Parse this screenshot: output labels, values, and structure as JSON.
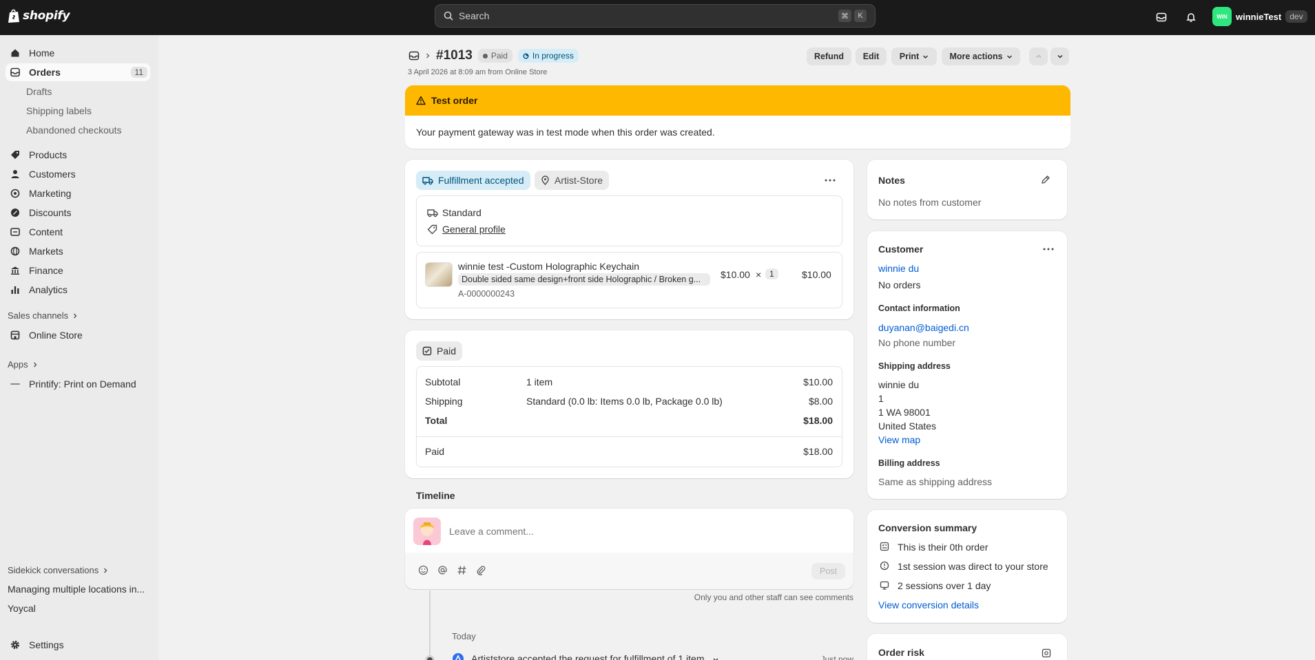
{
  "topbar": {
    "logo_text": "shopify",
    "search_placeholder": "Search",
    "shortcut_cmd": "⌘",
    "shortcut_key": "K",
    "user_initials": "WIN",
    "user_name": "winnieTest",
    "user_tag": "dev"
  },
  "sidebar": {
    "home": "Home",
    "orders": "Orders",
    "orders_count": "11",
    "drafts": "Drafts",
    "shipping_labels": "Shipping labels",
    "abandoned": "Abandoned checkouts",
    "products": "Products",
    "customers": "Customers",
    "marketing": "Marketing",
    "discounts": "Discounts",
    "content": "Content",
    "markets": "Markets",
    "finance": "Finance",
    "analytics": "Analytics",
    "sales_channels": "Sales channels",
    "online_store": "Online Store",
    "apps": "Apps",
    "printify": "Printify: Print on Demand",
    "sidekick": "Sidekick conversations",
    "conv1": "Managing multiple locations in...",
    "conv2": "Yoycal",
    "settings": "Settings"
  },
  "header": {
    "order_number": "#1013",
    "badge_paid": "Paid",
    "badge_progress": "In progress",
    "subtitle": "3 April 2026 at 8:09 am from Online Store",
    "refund": "Refund",
    "edit": "Edit",
    "print": "Print",
    "more_actions": "More actions"
  },
  "banner": {
    "title": "Test order",
    "body": "Your payment gateway was in test mode when this order was created."
  },
  "fulfillment": {
    "status": "Fulfillment accepted",
    "location": "Artist-Store",
    "method": "Standard",
    "profile": "General profile",
    "item_title": "winnie test -Custom Holographic Keychain",
    "item_variant": "Double sided same design+front side Holographic / Broken g...",
    "item_sku": "A-0000000243",
    "item_price": "$10.00",
    "item_times": "×",
    "item_qty": "1",
    "item_total": "$10.00"
  },
  "payment": {
    "badge": "Paid",
    "subtotal_label": "Subtotal",
    "subtotal_desc": "1 item",
    "subtotal_value": "$10.00",
    "shipping_label": "Shipping",
    "shipping_desc": "Standard (0.0 lb: Items 0.0 lb, Package 0.0 lb)",
    "shipping_value": "$8.00",
    "total_label": "Total",
    "total_value": "$18.00",
    "paid_label": "Paid",
    "paid_value": "$18.00"
  },
  "timeline": {
    "title": "Timeline",
    "comment_placeholder": "Leave a comment...",
    "post": "Post",
    "staff_note": "Only you and other staff can see comments",
    "today": "Today",
    "event": "Artiststore accepted the request for fulfillment of 1 item",
    "event_time": "Just now"
  },
  "notes": {
    "title": "Notes",
    "body": "No notes from customer"
  },
  "customer": {
    "title": "Customer",
    "name": "winnie du",
    "orders": "No orders",
    "contact_title": "Contact information",
    "email": "duyanan@baigedi.cn",
    "phone": "No phone number",
    "shipping_title": "Shipping address",
    "addr1": "winnie du",
    "addr2": "1",
    "addr3": "1 WA 98001",
    "addr4": "United States",
    "view_map": "View map",
    "billing_title": "Billing address",
    "billing_body": "Same as shipping address"
  },
  "conversion": {
    "title": "Conversion summary",
    "line1": "This is their 0th order",
    "line2": "1st session was direct to your store",
    "line3": "2 sessions over 1 day",
    "link": "View conversion details"
  },
  "risk": {
    "title": "Order risk"
  }
}
